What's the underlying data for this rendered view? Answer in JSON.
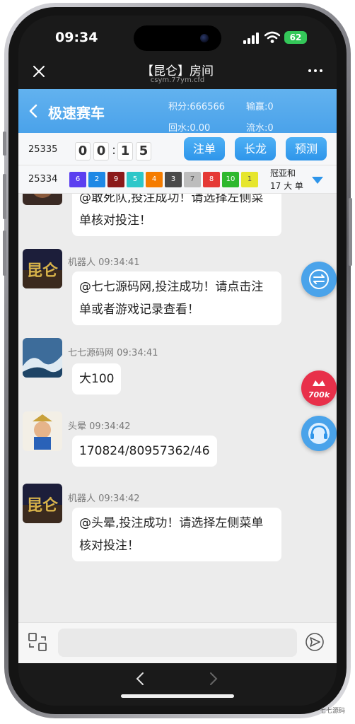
{
  "status_bar": {
    "time": "09:34",
    "battery": "62"
  },
  "browser": {
    "title": "【昆仑】房间",
    "url": "csym.77ym.cfd"
  },
  "header": {
    "title": "极速赛车",
    "points": "积分:666566",
    "win_loss": "输赢:0",
    "rebate": "回水:0.00",
    "turnover": "流水:0"
  },
  "current_draw": {
    "issue": "25335",
    "countdown": [
      "0",
      "0",
      "1",
      "5"
    ],
    "buttons": [
      "注单",
      "长龙",
      "预测"
    ]
  },
  "last_draw": {
    "issue": "25334",
    "numbers": [
      {
        "n": "6",
        "color": "#5b3ff0"
      },
      {
        "n": "2",
        "color": "#1e88e5"
      },
      {
        "n": "9",
        "color": "#8b1a1a"
      },
      {
        "n": "5",
        "color": "#2ec7c9"
      },
      {
        "n": "4",
        "color": "#f57c00"
      },
      {
        "n": "3",
        "color": "#4a4a4a"
      },
      {
        "n": "7",
        "color": "#bdbdbd"
      },
      {
        "n": "8",
        "color": "#e53935"
      },
      {
        "n": "10",
        "color": "#2db82d"
      },
      {
        "n": "1",
        "color": "#e6e62e"
      }
    ],
    "result_label": "冠亚和",
    "result_value": "17 大 单"
  },
  "messages": [
    {
      "sender": "",
      "text_lines": [
        "@敢死队,投注成功！请选择左侧菜",
        "单核对投注！"
      ]
    },
    {
      "sender": "机器人 09:34:41",
      "text_lines": [
        "@七七源码网,投注成功！请点击注",
        "单或者游戏记录查看！"
      ]
    },
    {
      "sender": "七七源码网 09:34:41",
      "text_lines": [
        "大100"
      ]
    },
    {
      "sender": "头晕 09:34:42",
      "text_lines": [
        "170824/80957362/46"
      ]
    },
    {
      "sender": "机器人 09:34:42",
      "text_lines": [
        "@头晕,投注成功！请选择左侧菜单",
        "核对投注！"
      ]
    }
  ],
  "float_badge": "700k",
  "logo_text": "昆仑",
  "watermark": "七七源码"
}
